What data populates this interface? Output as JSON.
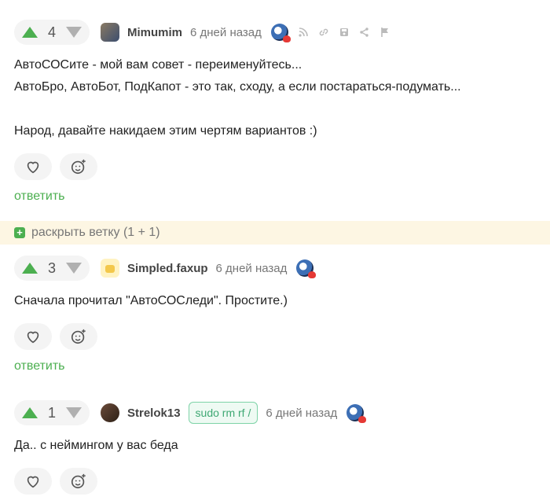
{
  "comments": [
    {
      "score": "4",
      "username": "Mimumim",
      "time": "6 дней назад",
      "lines": [
        "АвтоСОСите - мой вам совет - переименуйтесь...",
        "АвтоБро, АвтоБот, ПодКапот - это так, сходу, а если постараться-подумать...",
        "",
        "Народ, давайте накидаем этим чертям вариантов :)"
      ],
      "reply_label": "ответить"
    },
    {
      "score": "3",
      "username": "Simpled.faxup",
      "time": "6 дней назад",
      "lines": [
        "Сначала прочитал \"АвтоСОСледи\". Простите.)"
      ],
      "reply_label": "ответить"
    },
    {
      "score": "1",
      "username": "Strelok13",
      "tag": "sudo rm rf /",
      "time": "6 дней назад",
      "lines": [
        "Да.. с неймингом у вас беда"
      ]
    }
  ],
  "branch": {
    "plus": "+",
    "label": "раскрыть ветку (1 + 1)"
  },
  "colors": {
    "accent": "#4caf50",
    "branch_bg": "#fdf6e3",
    "tag_border": "#7ed3a7"
  },
  "icons": {
    "toolbar": [
      "rss-icon",
      "link-icon",
      "save-icon",
      "share-icon",
      "flag-icon"
    ],
    "actions": [
      "heart-icon",
      "add-emoji-icon"
    ]
  }
}
